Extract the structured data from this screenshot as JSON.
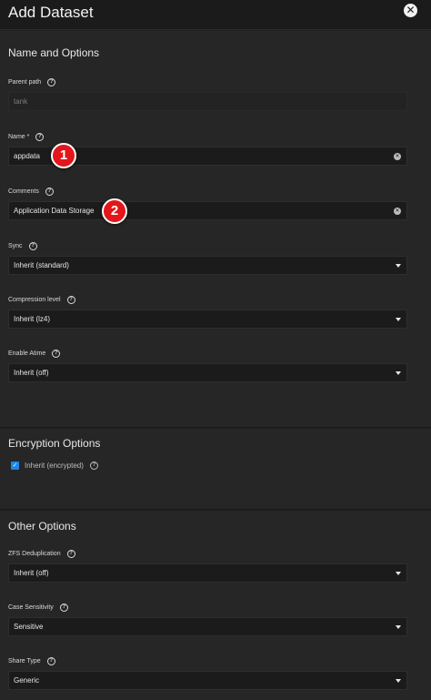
{
  "header": {
    "title": "Add Dataset",
    "close_icon": "close-icon"
  },
  "sections": {
    "name_options": {
      "title": "Name and Options"
    },
    "encryption": {
      "title": "Encryption Options"
    },
    "other": {
      "title": "Other Options"
    }
  },
  "fields": {
    "parent_path": {
      "label": "Parent path",
      "value": "tank"
    },
    "name": {
      "label": "Name *",
      "value": "appdata"
    },
    "comments": {
      "label": "Comments",
      "value": "Application Data Storage"
    },
    "sync": {
      "label": "Sync",
      "value": "Inherit (standard)"
    },
    "compression": {
      "label": "Compression level",
      "value": "Inherit (lz4)"
    },
    "atime": {
      "label": "Enable Atime",
      "value": "Inherit (off)"
    },
    "encryption_inherit": {
      "label": "Inherit (encrypted)",
      "checked": true
    },
    "dedup": {
      "label": "ZFS Deduplication",
      "value": "Inherit (off)"
    },
    "case_sensitivity": {
      "label": "Case Sensitivity",
      "value": "Sensitive"
    },
    "share_type": {
      "label": "Share Type",
      "value": "Generic"
    }
  },
  "badges": {
    "one": "1",
    "two": "2"
  },
  "colors": {
    "accent": "#1e88e5",
    "badge": "#e3161b"
  }
}
